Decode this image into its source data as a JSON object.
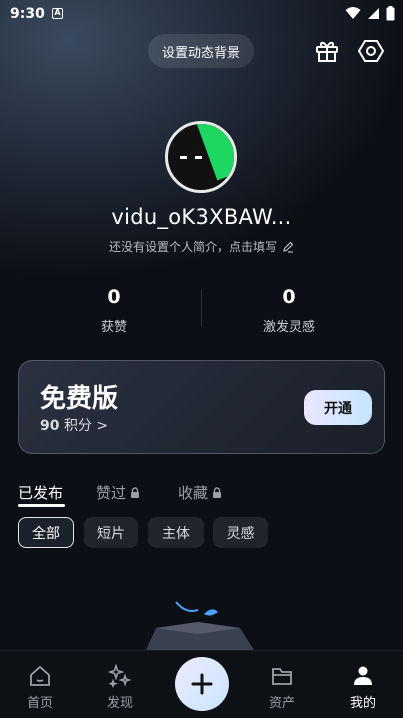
{
  "status_bar": {
    "time": "9:30",
    "notif_icon": "A"
  },
  "header": {
    "set_background_label": "设置动态背景"
  },
  "profile": {
    "username": "vidu_oK3XBAW...",
    "bio_placeholder": "还没有设置个人简介，点击填写"
  },
  "stats": [
    {
      "value": "0",
      "label": "获赞"
    },
    {
      "value": "0",
      "label": "激发灵感"
    }
  ],
  "plan": {
    "title": "免费版",
    "points_value": "90",
    "points_label": "积分 >",
    "open_label": "开通"
  },
  "tabs": [
    {
      "label": "已发布",
      "locked": false
    },
    {
      "label": "赞过",
      "locked": true
    },
    {
      "label": "收藏",
      "locked": true
    }
  ],
  "filters": [
    "全部",
    "短片",
    "主体",
    "灵感"
  ],
  "bottom_nav": [
    {
      "label": "首页",
      "icon": "home-icon"
    },
    {
      "label": "发现",
      "icon": "sparkle-icon"
    },
    {
      "label": "资产",
      "icon": "folder-icon"
    },
    {
      "label": "我的",
      "icon": "user-icon"
    }
  ],
  "colors": {
    "accent_gradient_start": "#efe8ff",
    "accent_gradient_end": "#c7e7ff",
    "avatar_green": "#1ed760"
  }
}
